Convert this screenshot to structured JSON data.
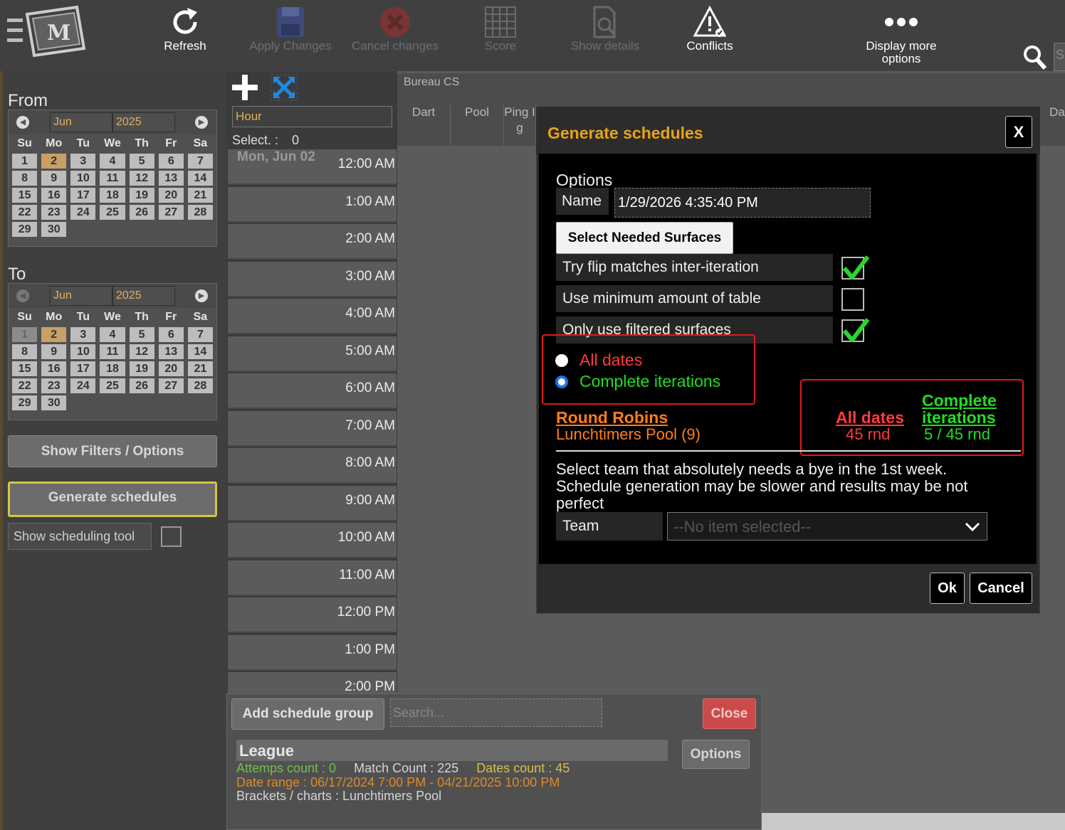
{
  "toolbar": {
    "refresh": "Refresh",
    "apply_changes": "Apply Changes",
    "cancel_changes": "Cancel changes",
    "score": "Score",
    "show_details": "Show details",
    "conflicts": "Conflicts",
    "display_more": "Display more",
    "display_more_2": "options",
    "search_stub": "S"
  },
  "from": {
    "title": "From",
    "month": "Jun",
    "year": "2025",
    "days_of_week": [
      "Su",
      "Mo",
      "Tu",
      "We",
      "Th",
      "Fr",
      "Sa"
    ],
    "days": [
      "1",
      "2",
      "3",
      "4",
      "5",
      "6",
      "7",
      "8",
      "9",
      "10",
      "11",
      "12",
      "13",
      "14",
      "15",
      "16",
      "17",
      "18",
      "19",
      "20",
      "21",
      "22",
      "23",
      "24",
      "25",
      "26",
      "27",
      "28",
      "29",
      "30"
    ],
    "selected": "2"
  },
  "to": {
    "title": "To",
    "month": "Jun",
    "year": "2025",
    "days_of_week": [
      "Su",
      "Mo",
      "Tu",
      "We",
      "Th",
      "Fr",
      "Sa"
    ],
    "days": [
      "1",
      "2",
      "3",
      "4",
      "5",
      "6",
      "7",
      "8",
      "9",
      "10",
      "11",
      "12",
      "13",
      "14",
      "15",
      "16",
      "17",
      "18",
      "19",
      "20",
      "21",
      "22",
      "23",
      "24",
      "25",
      "26",
      "27",
      "28",
      "29",
      "30"
    ],
    "selected": "2",
    "disabled": "1"
  },
  "left_panel": {
    "show_filters": "Show Filters / Options",
    "generate": "Generate schedules",
    "show_tool": "Show scheduling tool"
  },
  "timeline": {
    "granularity": "Hour",
    "select_label": "Select. :",
    "select_value": "0",
    "day_label": "Mon, Jun 02",
    "hours": [
      "12:00 AM",
      "1:00 AM",
      "2:00 AM",
      "3:00 AM",
      "4:00 AM",
      "5:00 AM",
      "6:00 AM",
      "7:00 AM",
      "8:00 AM",
      "9:00 AM",
      "10:00 AM",
      "11:00 AM",
      "12:00 PM",
      "1:00 PM",
      "2:00 PM"
    ]
  },
  "grid": {
    "bureau": "Bureau CS",
    "columns": [
      "Dart",
      "Pool",
      "Ping I",
      "Da"
    ],
    "ping_line2": "g"
  },
  "schedule_group": {
    "add_button": "Add schedule group",
    "search_placeholder": "Search...",
    "close_button": "Close",
    "options_button": "Options",
    "league_title": "League",
    "attempts": "Attemps count : 0",
    "match_count": "Match Count : 225",
    "dates_count": "Dates count : 45",
    "date_range": "Date range : 06/17/2024 7:00 PM - 04/21/2025 10:00 PM",
    "brackets": "Brackets / charts : Lunchtimers Pool"
  },
  "modal": {
    "title": "Generate schedules",
    "close_x": "X",
    "options_label": "Options",
    "name_label": "Name",
    "name_value": "1/29/2026 4:35:40 PM",
    "select_surfaces": "Select Needed Surfaces",
    "opt_flip": "Try flip matches inter-iteration",
    "opt_flip_checked": true,
    "opt_min_table": "Use minimum amount of table",
    "opt_min_table_checked": false,
    "opt_filtered": "Only use filtered surfaces",
    "opt_filtered_checked": true,
    "radio_all": "All dates",
    "radio_complete": "Complete iterations",
    "rr_title": "Round Robins",
    "rr_sub": "Lunchtimers Pool (9)",
    "hdr_all": "All dates",
    "hdr_complete_1": "Complete",
    "hdr_complete_2": "iterations",
    "val_all": "45 rnd",
    "val_complete": "5 / 45 rnd",
    "bye_text_1": "Select team that absolutely needs a bye in the 1st week.",
    "bye_text_2": "Schedule generation may be slower and results may be not",
    "bye_text_3": "perfect",
    "team_label": "Team",
    "team_placeholder": "--No item selected--",
    "ok": "Ok",
    "cancel": "Cancel"
  },
  "colors": {
    "accent_title": "#e8a317",
    "red": "#ff3b3b",
    "green": "#22dd22",
    "orange": "#ff7d1a"
  }
}
